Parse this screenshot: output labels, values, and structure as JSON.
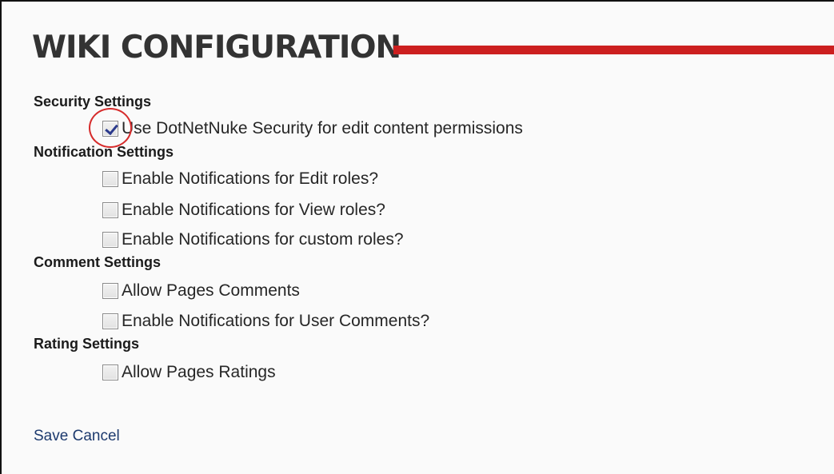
{
  "header": {
    "title": "WIKI CONFIGURATION",
    "accent_color": "#cc1f1f"
  },
  "sections": [
    {
      "heading": "Security Settings",
      "options": [
        {
          "label": "Use DotNetNuke Security for edit content permissions",
          "checked": true
        }
      ]
    },
    {
      "heading": "Notification Settings",
      "options": [
        {
          "label": "Enable Notifications for Edit roles?",
          "checked": false
        },
        {
          "label": "Enable Notifications for View roles?",
          "checked": false
        },
        {
          "label": "Enable Notifications for custom roles?",
          "checked": false
        }
      ]
    },
    {
      "heading": "Comment Settings",
      "options": [
        {
          "label": "Allow Pages Comments",
          "checked": false
        },
        {
          "label": "Enable Notifications for User Comments?",
          "checked": false
        }
      ]
    },
    {
      "heading": "Rating Settings",
      "options": [
        {
          "label": "Allow Pages Ratings",
          "checked": false
        }
      ]
    }
  ],
  "actions": {
    "save_label": "Save",
    "cancel_label": "Cancel",
    "link_color": "#1d3a6e"
  },
  "annotation": {
    "highlight_color": "#d62b2b"
  }
}
